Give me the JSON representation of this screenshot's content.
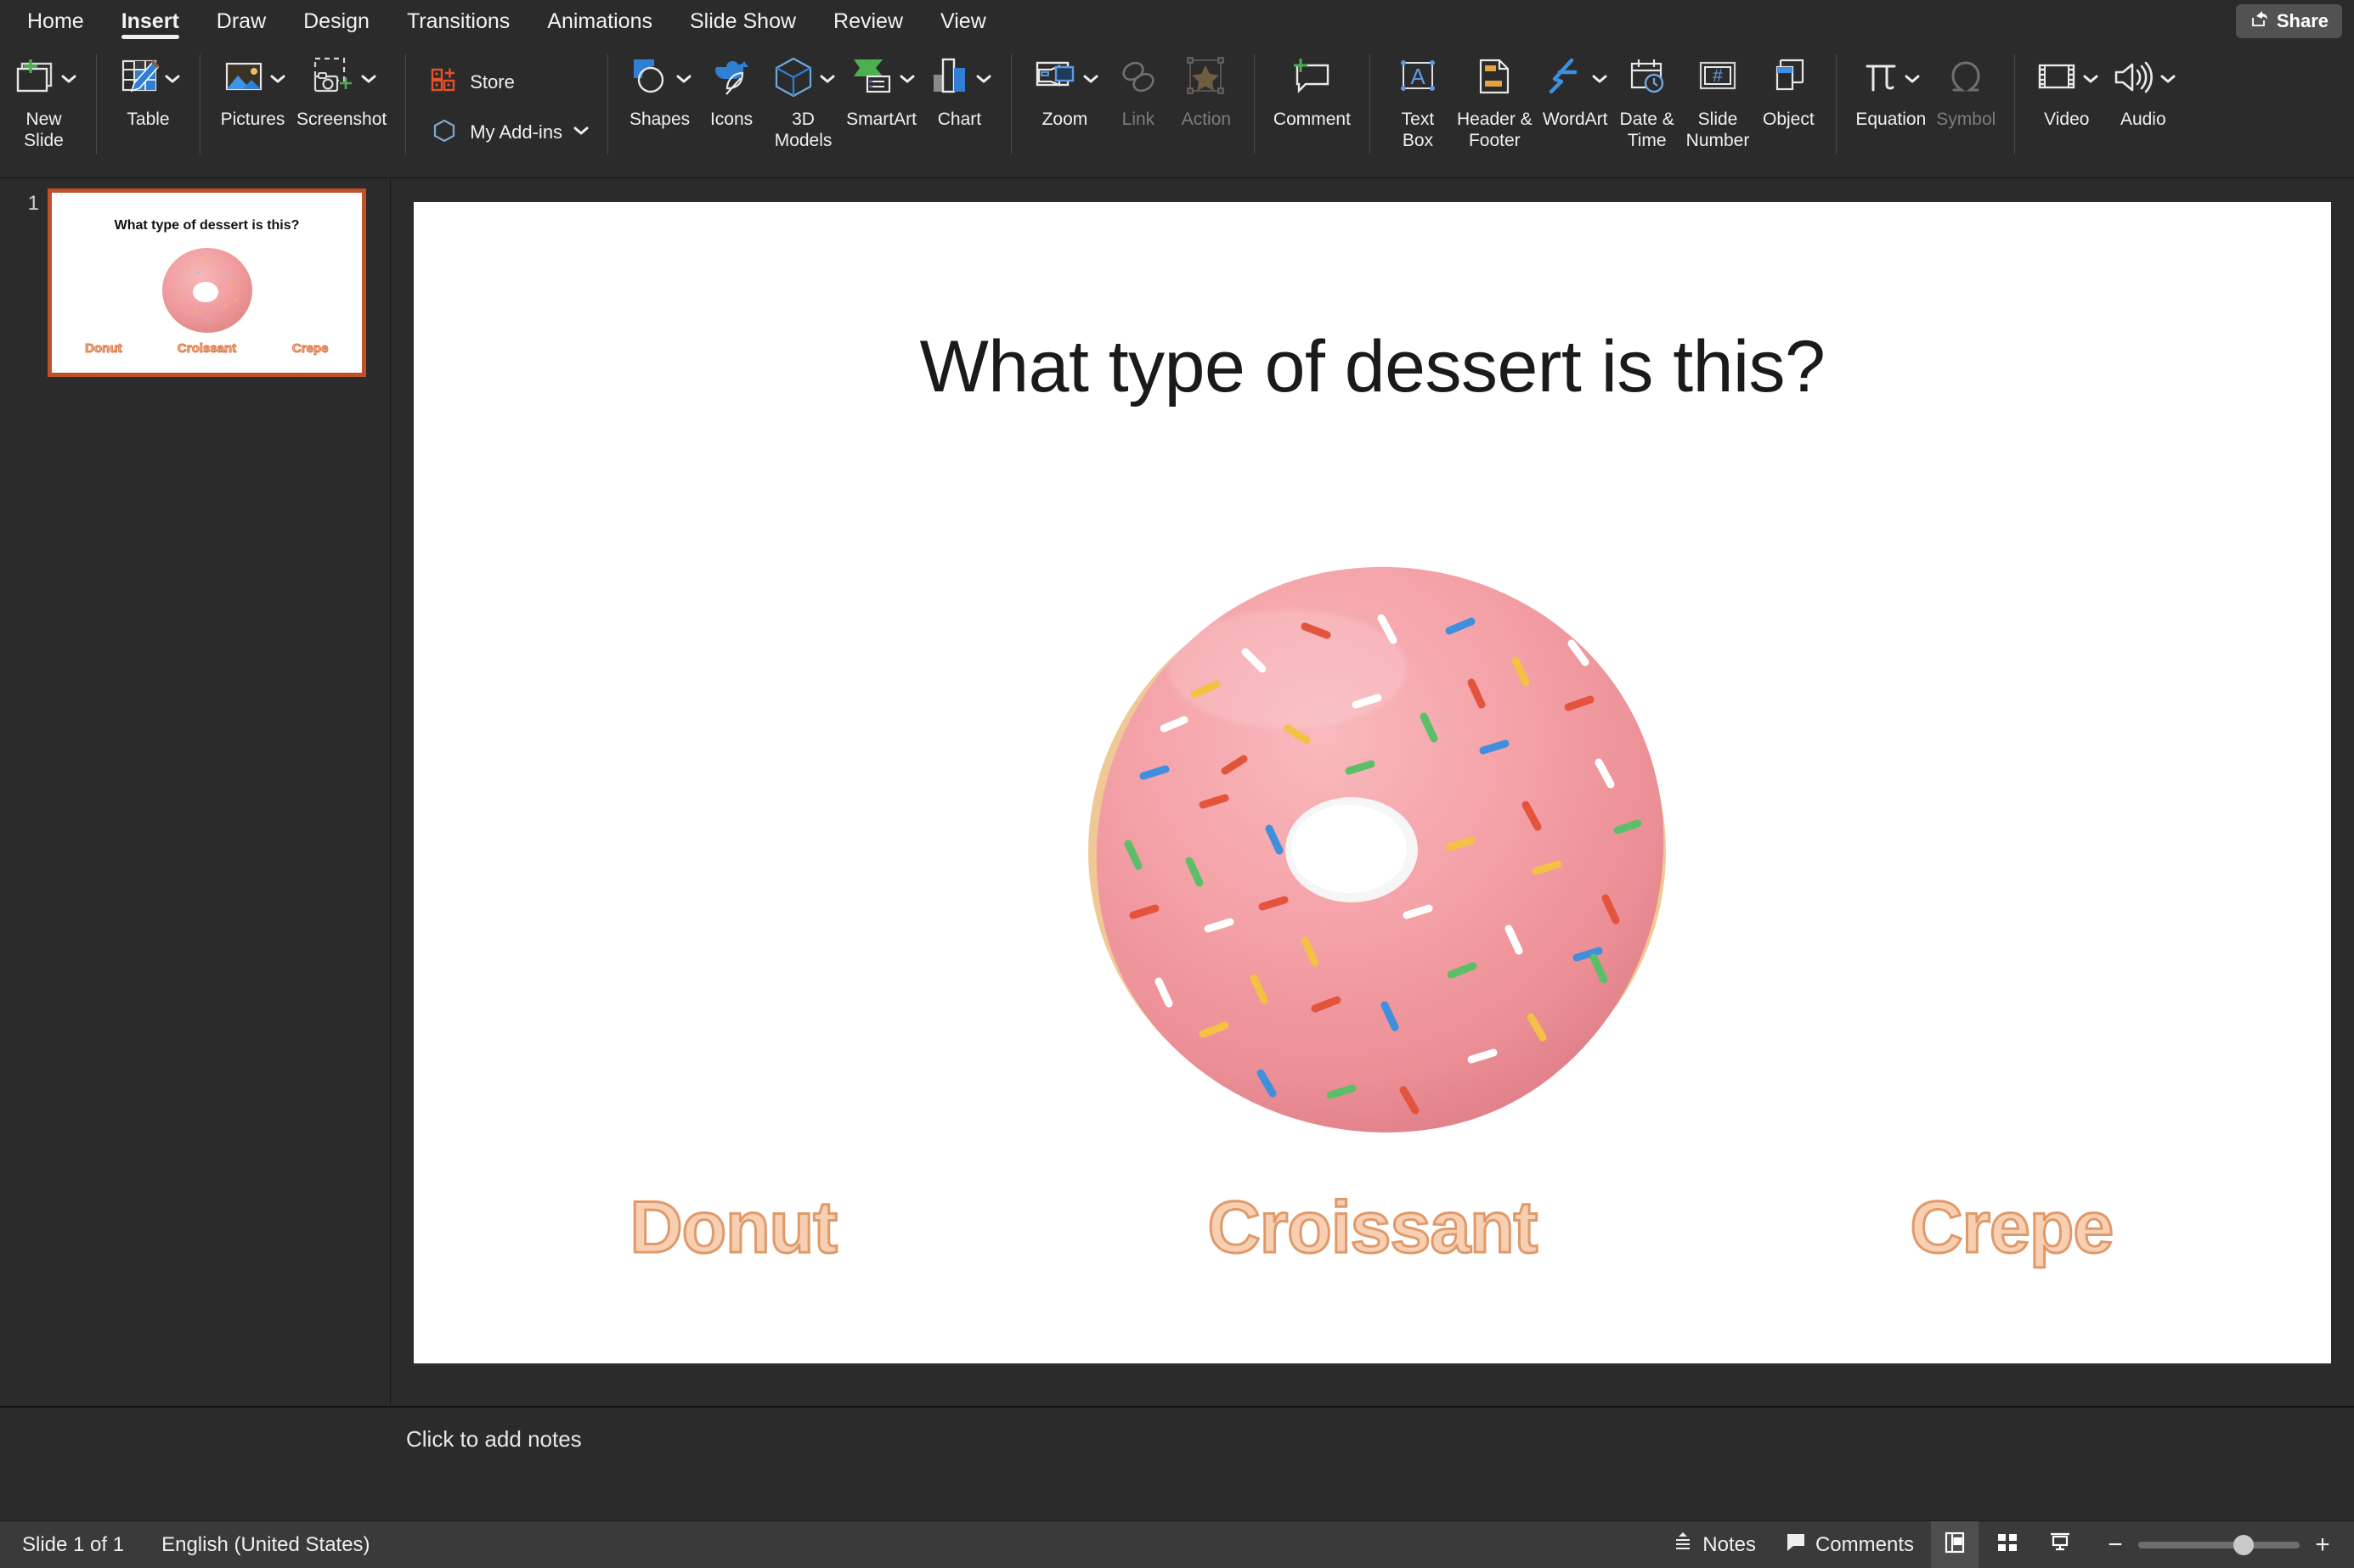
{
  "window": {
    "share_label": "Share"
  },
  "tabs": [
    {
      "label": "Home",
      "active": false
    },
    {
      "label": "Insert",
      "active": true
    },
    {
      "label": "Draw",
      "active": false
    },
    {
      "label": "Design",
      "active": false
    },
    {
      "label": "Transitions",
      "active": false
    },
    {
      "label": "Animations",
      "active": false
    },
    {
      "label": "Slide Show",
      "active": false
    },
    {
      "label": "Review",
      "active": false
    },
    {
      "label": "View",
      "active": false
    }
  ],
  "ribbon": {
    "new_slide": "New\nSlide",
    "table": "Table",
    "pictures": "Pictures",
    "screenshot": "Screenshot",
    "store": "Store",
    "my_addins": "My Add-ins",
    "shapes": "Shapes",
    "icons": "Icons",
    "models3d": "3D\nModels",
    "smartart": "SmartArt",
    "chart": "Chart",
    "zoom": "Zoom",
    "link": "Link",
    "action": "Action",
    "comment": "Comment",
    "text_box": "Text\nBox",
    "header_footer": "Header &\nFooter",
    "wordart": "WordArt",
    "date_time": "Date &\nTime",
    "slide_number": "Slide\nNumber",
    "object": "Object",
    "equation": "Equation",
    "symbol": "Symbol",
    "video": "Video",
    "audio": "Audio"
  },
  "thumbnail": {
    "number": "1",
    "title": "What type of dessert is this?",
    "options": [
      "Donut",
      "Croissant",
      "Crepe"
    ]
  },
  "slide": {
    "title": "What type of dessert is this?",
    "options": [
      "Donut",
      "Croissant",
      "Crepe"
    ],
    "image_alt": "pink-frosted-donut-with-sprinkles"
  },
  "notes": {
    "placeholder": "Click to add notes"
  },
  "status": {
    "slide_count": "Slide 1 of 1",
    "language": "English (United States)",
    "notes_label": "Notes",
    "comments_label": "Comments",
    "zoom_minus": "−",
    "zoom_plus": "+"
  },
  "colors": {
    "accent_orange": "#c0502a",
    "ribbon_bg": "#2b2b2b",
    "statusbar_bg": "#3a3a3a",
    "word_fill": "#f7cfb2",
    "word_stroke": "#e09a6a"
  }
}
